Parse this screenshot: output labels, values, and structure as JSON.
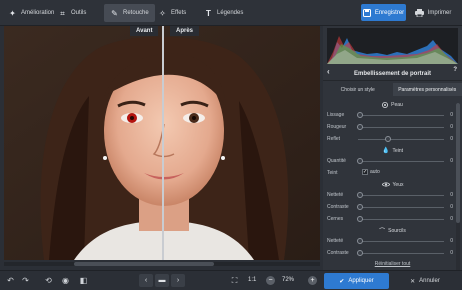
{
  "toolbar": {
    "tabs": [
      {
        "label": "Amélioration",
        "icon": "magic-wand-icon"
      },
      {
        "label": "Outils",
        "icon": "crop-icon"
      },
      {
        "label": "Retouche",
        "icon": "brush-icon"
      },
      {
        "label": "Effets",
        "icon": "sparkle-icon"
      },
      {
        "label": "Légendes",
        "icon": "text-icon"
      }
    ],
    "active_tab": "Retouche",
    "save_label": "Enregistrer",
    "print_label": "Imprimer"
  },
  "photo": {
    "before_label": "Avant",
    "after_label": "Après"
  },
  "panel": {
    "title": "Embellissement de portrait",
    "tabs": [
      "Choisir un style",
      "Paramètres personnalisés"
    ],
    "active_tab": "Paramètres personnalisés",
    "sections": {
      "peau": "Peau",
      "teint": "Teint",
      "yeux": "Yeux",
      "sourcils": "Sourcils"
    },
    "sliders": [
      {
        "label": "Lissage",
        "value": "0"
      },
      {
        "label": "Rougeur",
        "value": "0"
      },
      {
        "label": "Reflet",
        "value": "0"
      },
      {
        "label": "Quantité",
        "value": "0"
      },
      {
        "label": "Netteté",
        "value": "0"
      },
      {
        "label": "Contraste",
        "value": "0"
      },
      {
        "label": "Cernes",
        "value": "0"
      },
      {
        "label": "Netteté",
        "value": "0"
      },
      {
        "label": "Contraste",
        "value": "0"
      }
    ],
    "teint_label": "Teint",
    "teint_check_label": "auto",
    "reset_label": "Réinitialiser tout"
  },
  "bottom": {
    "ratio_label": "1:1",
    "zoom_value": "72%",
    "apply_label": "Appliquer",
    "cancel_label": "Annuler"
  },
  "colors": {
    "accent": "#2e7ad1",
    "background": "#2b2f36",
    "panel": "#30343b"
  }
}
